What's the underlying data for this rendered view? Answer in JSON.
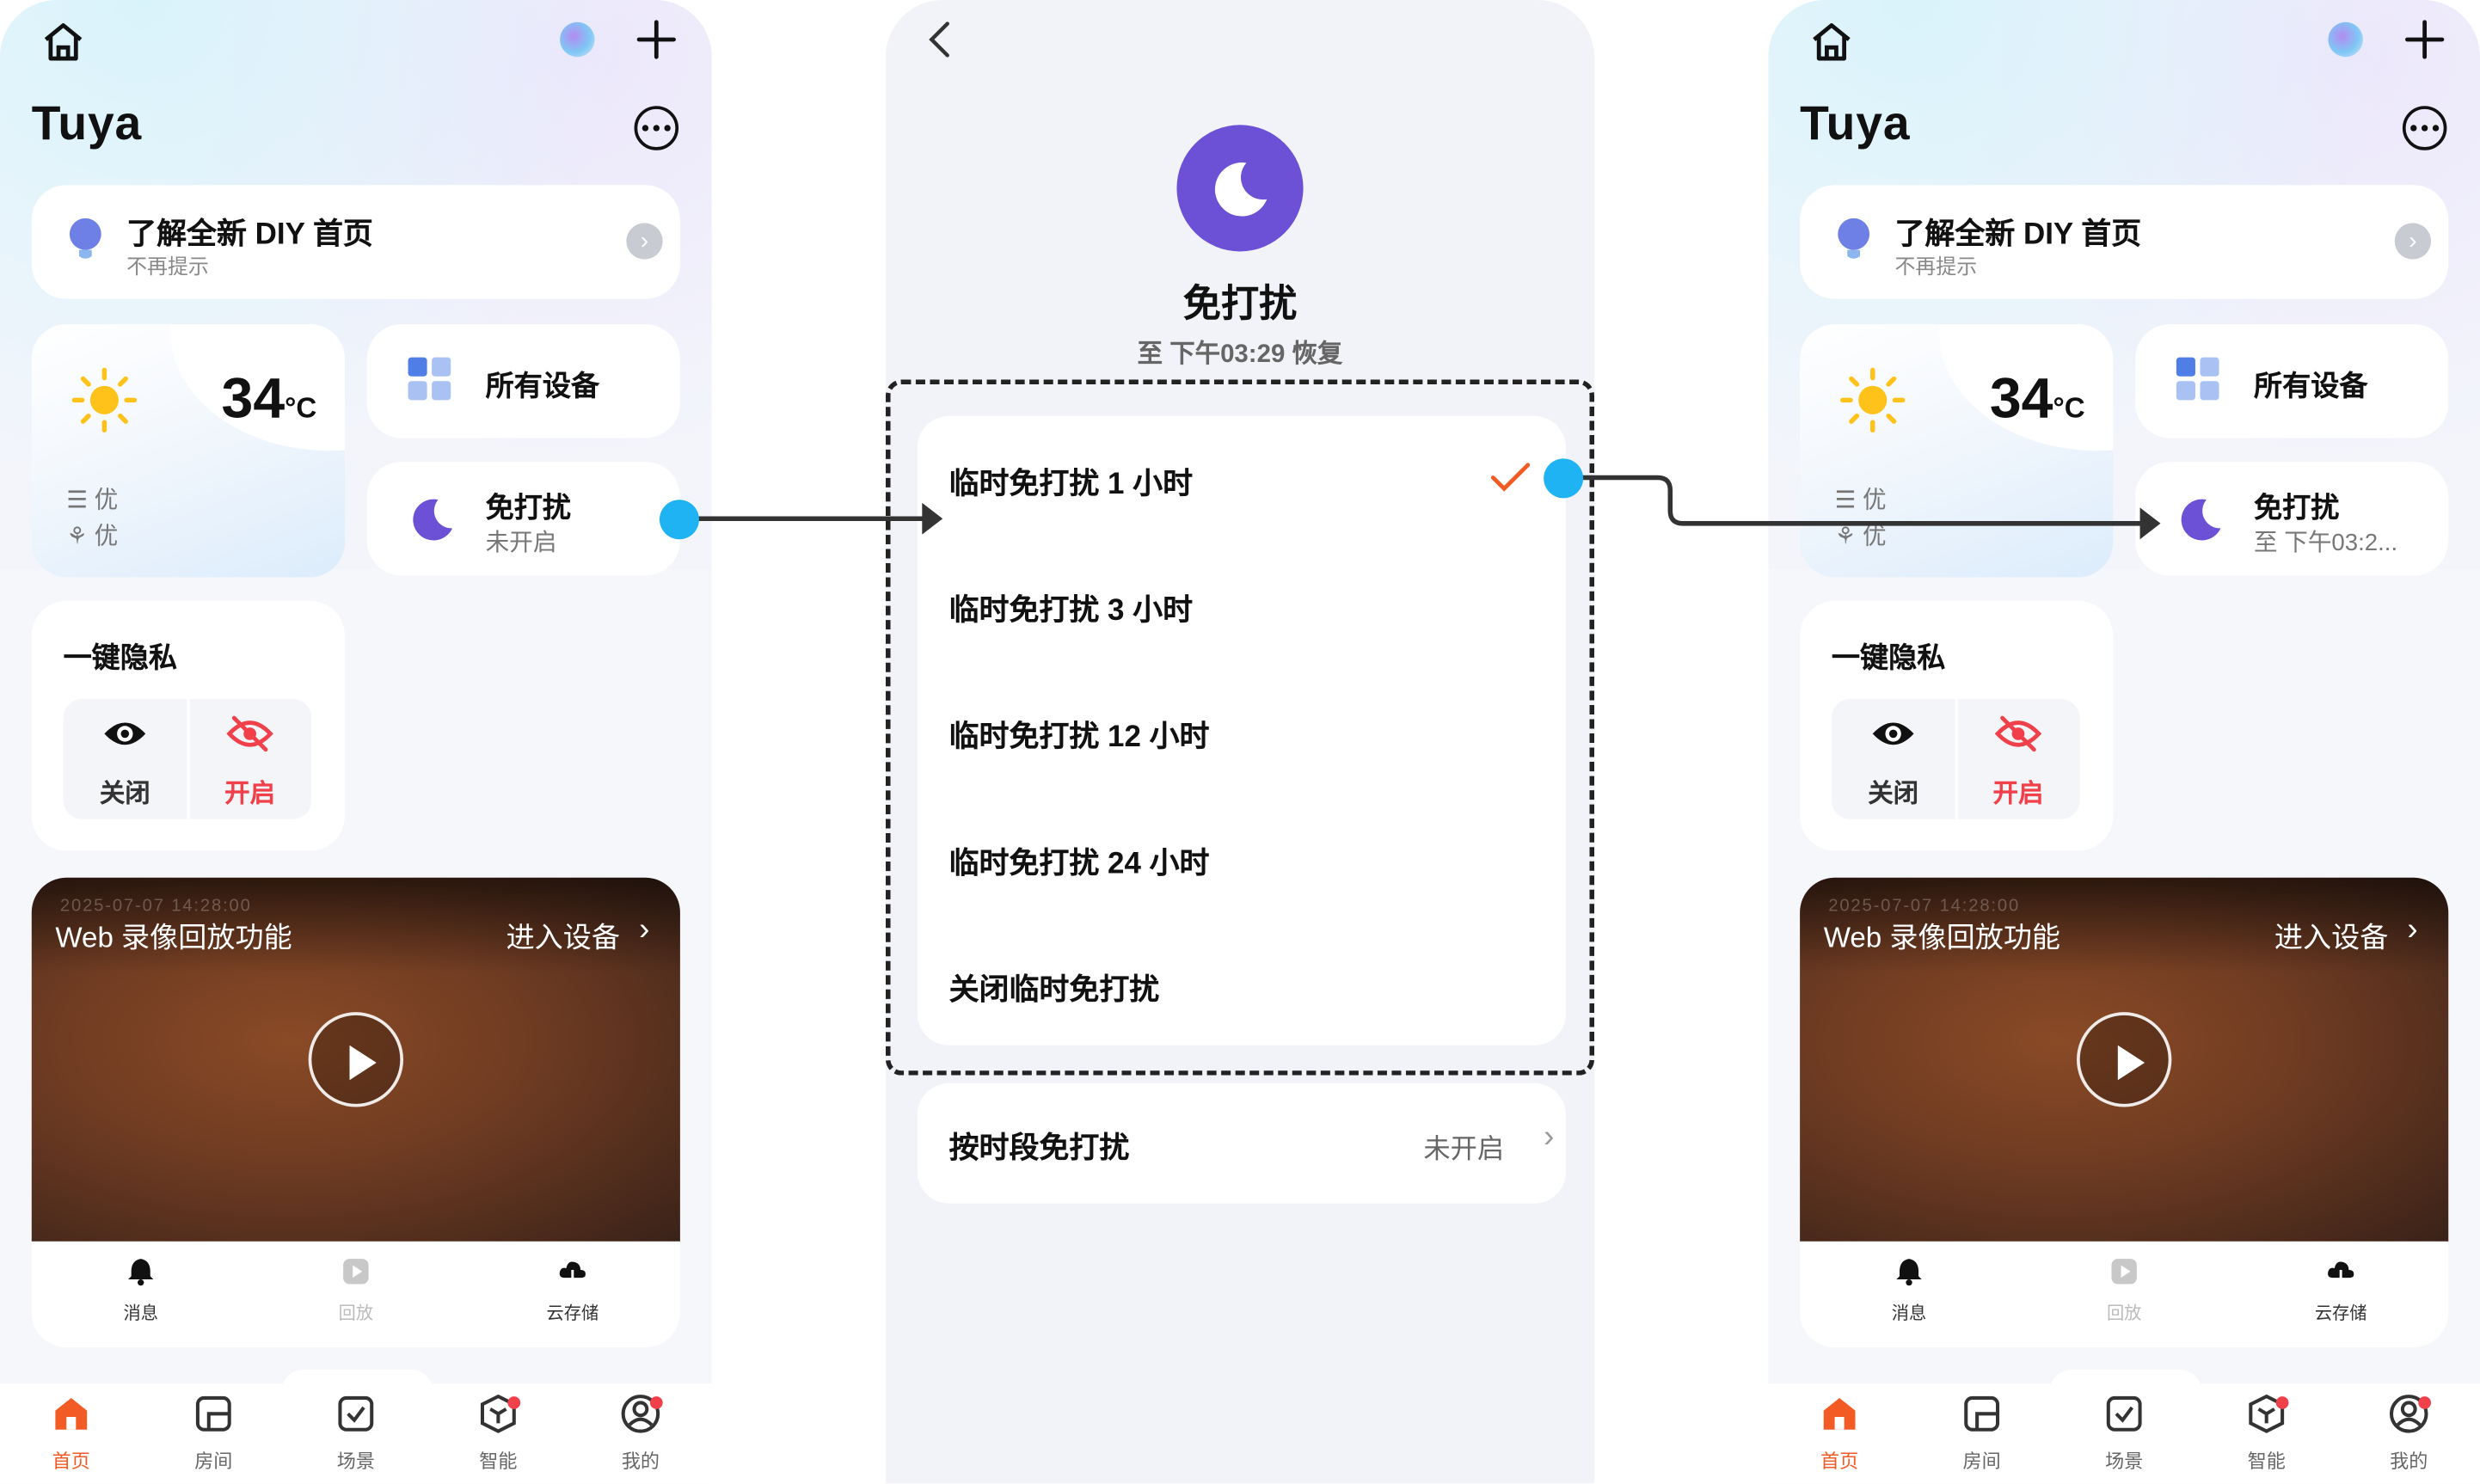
{
  "home_before": {
    "title": "Tuya",
    "tip": {
      "title": "了解全新 DIY 首页",
      "subtitle": "不再提示"
    },
    "weather": {
      "temp": "34",
      "unit": "°C",
      "air_quality": "优",
      "pollen": "优"
    },
    "all_devices": "所有设备",
    "dnd": {
      "label": "免打扰",
      "status": "未开启"
    },
    "privacy": {
      "title": "一键隐私",
      "off_label": "关闭",
      "on_label": "开启"
    },
    "video": {
      "timestamp": "2025-07-07 14:28:00",
      "title": "Web 录像回放功能",
      "enter": "进入设备",
      "bar": [
        "消息",
        "回放",
        "云存储"
      ]
    },
    "tabs": [
      "首页",
      "房间",
      "场景",
      "智能",
      "我的"
    ]
  },
  "dnd_panel": {
    "title": "免打扰",
    "subtitle": "至 下午03:29 恢复",
    "options": [
      "临时免打扰 1 小时",
      "临时免打扰 3 小时",
      "临时免打扰 12 小时",
      "临时免打扰 24 小时",
      "关闭临时免打扰"
    ],
    "selected_index": 0,
    "schedule": {
      "label": "按时段免打扰",
      "value": "未开启"
    }
  },
  "home_after": {
    "title": "Tuya",
    "tip": {
      "title": "了解全新 DIY 首页",
      "subtitle": "不再提示"
    },
    "weather": {
      "temp": "34",
      "unit": "°C",
      "air_quality": "优",
      "pollen": "优"
    },
    "all_devices": "所有设备",
    "dnd": {
      "label": "免打扰",
      "status": "至 下午03:2..."
    },
    "privacy": {
      "title": "一键隐私",
      "off_label": "关闭",
      "on_label": "开启"
    },
    "video": {
      "timestamp": "2025-07-07 14:28:00",
      "title": "Web 录像回放功能",
      "enter": "进入设备",
      "bar": [
        "消息",
        "回放",
        "云存储"
      ]
    },
    "tabs": [
      "首页",
      "房间",
      "场景",
      "智能",
      "我的"
    ]
  },
  "colors": {
    "accent_orange": "#f35b25",
    "moon_purple": "#6c50d6",
    "connector_blue": "#1fb3f3",
    "privacy_red": "#f0414b"
  }
}
